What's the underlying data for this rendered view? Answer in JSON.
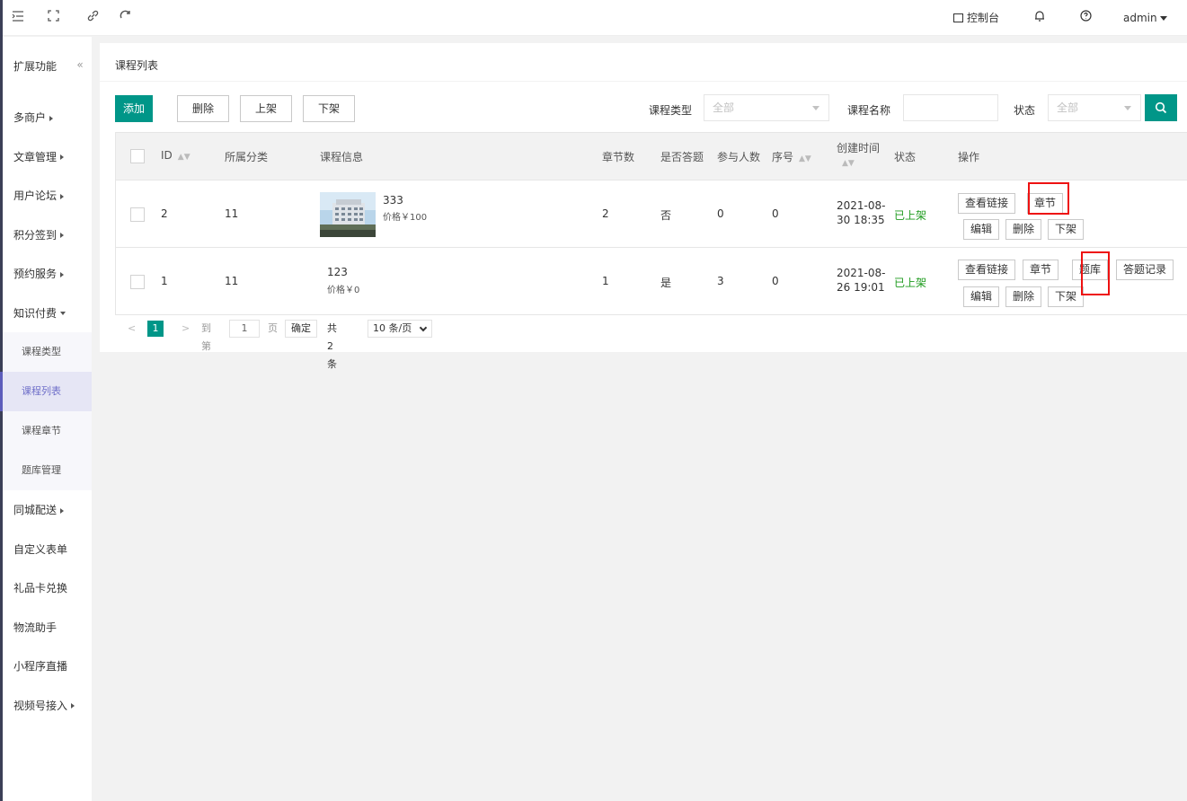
{
  "header": {
    "console_label": "控制台",
    "user_label": "admin"
  },
  "sidebar": {
    "title": "扩展功能",
    "collapse_glyph": "«",
    "items": [
      {
        "label": "多商户",
        "arrow": "right"
      },
      {
        "label": "文章管理",
        "arrow": "right"
      },
      {
        "label": "用户论坛",
        "arrow": "right"
      },
      {
        "label": "积分签到",
        "arrow": "right"
      },
      {
        "label": "预约服务",
        "arrow": "right"
      },
      {
        "label": "知识付费",
        "arrow": "down"
      }
    ],
    "subitems": [
      {
        "label": "课程类型",
        "active": false
      },
      {
        "label": "课程列表",
        "active": true
      },
      {
        "label": "课程章节",
        "active": false
      },
      {
        "label": "题库管理",
        "active": false
      }
    ],
    "items_after": [
      {
        "label": "同城配送",
        "arrow": "right"
      },
      {
        "label": "自定义表单",
        "arrow": ""
      },
      {
        "label": "礼品卡兑换",
        "arrow": ""
      },
      {
        "label": "物流助手",
        "arrow": ""
      },
      {
        "label": "小程序直播",
        "arrow": ""
      },
      {
        "label": "视频号接入",
        "arrow": "right"
      }
    ]
  },
  "card": {
    "title": "课程列表"
  },
  "toolbar": {
    "add": "添加",
    "delete": "删除",
    "on_shelf": "上架",
    "off_shelf": "下架"
  },
  "filters": {
    "course_type_label": "课程类型",
    "course_type_value": "全部",
    "course_name_label": "课程名称",
    "course_name_value": "",
    "status_label": "状态",
    "status_value": "全部"
  },
  "table": {
    "headers": {
      "id": "ID",
      "category": "所属分类",
      "info": "课程信息",
      "chapters": "章节数",
      "has_quiz": "是否答题",
      "participants": "参与人数",
      "order": "序号",
      "created": "创建时间",
      "status": "状态",
      "actions": "操作"
    },
    "rows": [
      {
        "id": "2",
        "category": "11",
        "name": "333",
        "price": "价格￥100",
        "chapters": "2",
        "has_quiz": "否",
        "participants": "0",
        "order": "0",
        "created_date": "2021-08-",
        "created_time": "30 18:35",
        "status": "已上架",
        "actions": {
          "link": "查看链接",
          "chapter": "章节",
          "edit": "编辑",
          "delete": "删除",
          "off": "下架"
        }
      },
      {
        "id": "1",
        "category": "11",
        "name": "123",
        "price": "价格￥0",
        "chapters": "1",
        "has_quiz": "是",
        "participants": "3",
        "order": "0",
        "created_date": "2021-08-",
        "created_time": "26 19:01",
        "status": "已上架",
        "actions": {
          "link": "查看链接",
          "chapter": "章节",
          "quiz": "题库",
          "records": "答题记录",
          "edit": "编辑",
          "delete": "删除",
          "off": "下架"
        }
      }
    ]
  },
  "pagination": {
    "prev": "<",
    "current": "1",
    "next": ">",
    "goto_label": "到第",
    "goto_value": "1",
    "page_suffix": "页",
    "confirm": "确定",
    "total": "共 2 条",
    "per_page": "10 条/页"
  },
  "colors": {
    "primary": "#009688",
    "status_on": "#1e9b1e",
    "highlight": "#ee1111",
    "sidebar_active": "#6f6fc9"
  }
}
